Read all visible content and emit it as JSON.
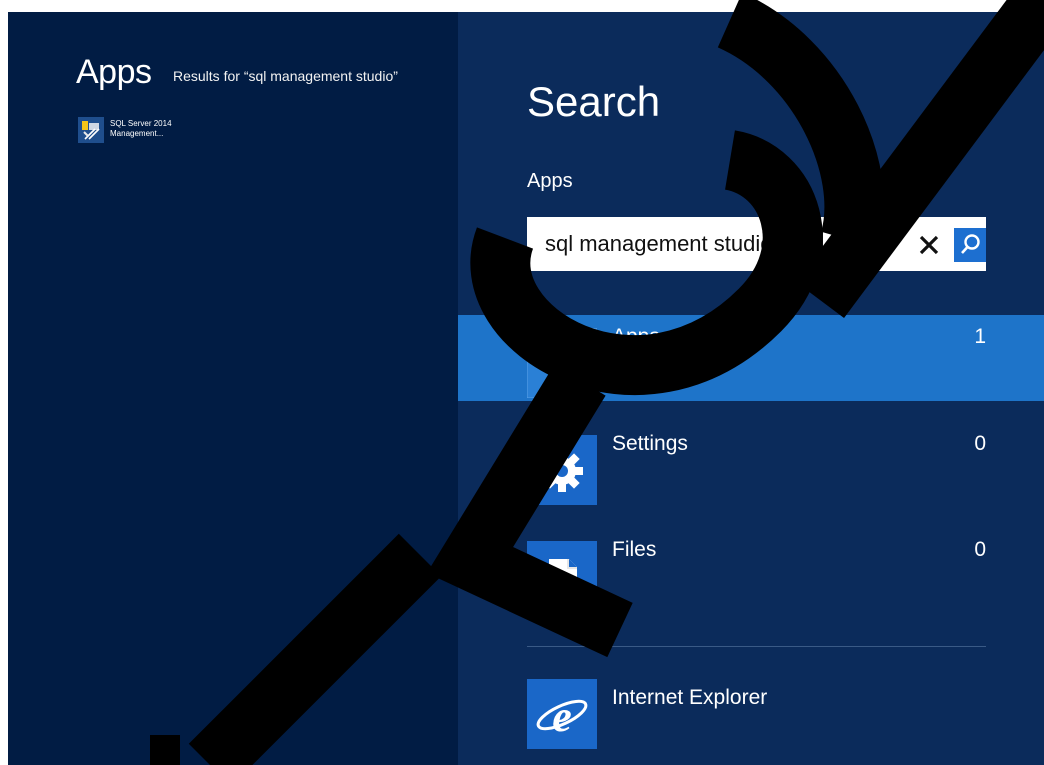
{
  "results": {
    "title": "Apps",
    "subtitle_prefix": "Results for ",
    "query_quoted": "“sql management studio”",
    "items": [
      {
        "line1": "SQL Server 2014",
        "line2": "Management...",
        "icon": "sql-server-management-studio-icon"
      }
    ]
  },
  "search": {
    "title": "Search",
    "scope": "Apps",
    "query": "sql management studio",
    "clear_icon": "close-icon",
    "search_icon": "search-icon",
    "categories": [
      {
        "label": "Apps",
        "count": "1",
        "icon": "monitor-keyboard-icon",
        "selected": true
      },
      {
        "label": "Settings",
        "count": "0",
        "icon": "gear-icon",
        "selected": false
      },
      {
        "label": "Files",
        "count": "0",
        "icon": "document-icon",
        "selected": false
      }
    ],
    "suggestions": [
      {
        "label": "Internet Explorer",
        "icon": "internet-explorer-icon"
      }
    ]
  },
  "colors": {
    "left_bg": "#011c44",
    "right_bg": "#0b2b5b",
    "selected_bg": "#1e74c9",
    "tile_blue": "#1a67c8",
    "watermark": "#000000"
  }
}
